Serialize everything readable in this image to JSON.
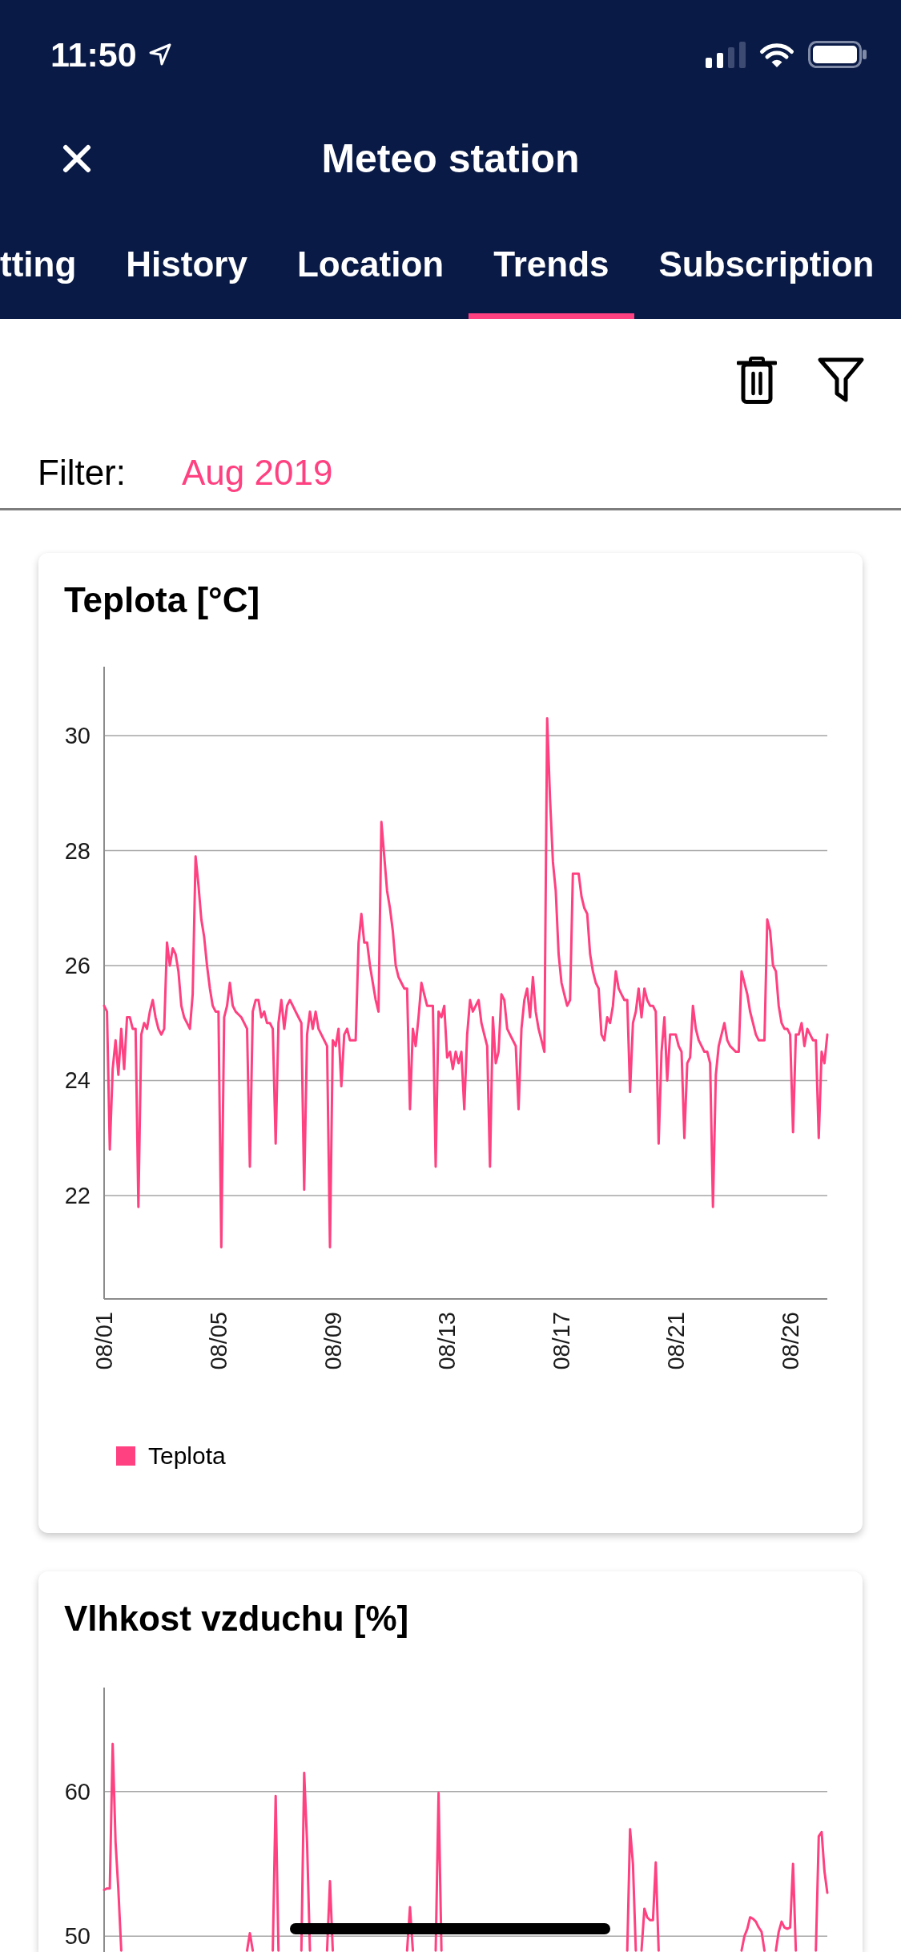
{
  "status_bar": {
    "time": "11:50"
  },
  "header": {
    "title": "Meteo station"
  },
  "tabs": [
    {
      "label": "tting",
      "selected": false
    },
    {
      "label": "History",
      "selected": false
    },
    {
      "label": "Location",
      "selected": false
    },
    {
      "label": "Trends",
      "selected": true
    },
    {
      "label": "Subscription",
      "selected": false
    }
  ],
  "filter": {
    "label": "Filter:",
    "value": "Aug 2019"
  },
  "charts": [
    {
      "title": "Teplota [°C]",
      "chart_data": {
        "type": "line",
        "grid": true,
        "categories": [
          "08/01",
          null,
          null,
          null,
          null,
          null,
          null,
          null,
          null,
          null,
          null,
          null,
          null,
          null,
          null,
          null,
          null,
          null,
          null,
          null,
          null,
          null,
          null,
          null,
          null,
          null,
          null,
          null,
          null,
          null,
          null,
          null,
          null,
          null,
          null,
          null,
          null,
          null,
          null,
          null,
          "08/05",
          null,
          null,
          null,
          null,
          null,
          null,
          null,
          null,
          null,
          null,
          null,
          null,
          null,
          null,
          null,
          null,
          null,
          null,
          null,
          null,
          null,
          null,
          null,
          null,
          null,
          null,
          null,
          null,
          null,
          null,
          null,
          null,
          null,
          null,
          null,
          null,
          null,
          null,
          null,
          "08/09",
          null,
          null,
          null,
          null,
          null,
          null,
          null,
          null,
          null,
          null,
          null,
          null,
          null,
          null,
          null,
          null,
          null,
          null,
          null,
          null,
          null,
          null,
          null,
          null,
          null,
          null,
          null,
          null,
          null,
          null,
          null,
          null,
          null,
          null,
          null,
          null,
          null,
          null,
          null,
          "08/13",
          null,
          null,
          null,
          null,
          null,
          null,
          null,
          null,
          null,
          null,
          null,
          null,
          null,
          null,
          null,
          null,
          null,
          null,
          null,
          null,
          null,
          null,
          null,
          null,
          null,
          null,
          null,
          null,
          null,
          null,
          null,
          null,
          null,
          null,
          null,
          null,
          null,
          null,
          null,
          "08/17",
          null,
          null,
          null,
          null,
          null,
          null,
          null,
          null,
          null,
          null,
          null,
          null,
          null,
          null,
          null,
          null,
          null,
          null,
          null,
          null,
          null,
          null,
          null,
          null,
          null,
          null,
          null,
          null,
          null,
          null,
          null,
          null,
          null,
          null,
          null,
          null,
          null,
          null,
          null,
          "08/21",
          null,
          null,
          null,
          null,
          null,
          null,
          null,
          null,
          null,
          null,
          null,
          null,
          null,
          null,
          null,
          null,
          null,
          null,
          null,
          null,
          null,
          null,
          null,
          null,
          null,
          null,
          null,
          null,
          null,
          null,
          null,
          null,
          null,
          null,
          null,
          null,
          null,
          null,
          null,
          "08/26",
          null,
          null,
          null,
          null,
          null,
          null,
          null,
          null,
          null,
          null,
          null,
          null,
          null
        ],
        "series": [
          {
            "name": "Teplota",
            "color": "#ff4081",
            "values": [
              25.3,
              25.2,
              22.8,
              24.2,
              24.7,
              24.1,
              24.9,
              24.2,
              25.1,
              25.1,
              24.9,
              24.9,
              21.8,
              24.8,
              25.0,
              24.9,
              25.2,
              25.4,
              25.1,
              24.9,
              24.8,
              24.9,
              26.4,
              26.0,
              26.3,
              26.2,
              25.9,
              25.3,
              25.1,
              25.0,
              24.9,
              25.5,
              27.9,
              27.4,
              26.8,
              26.5,
              26.0,
              25.6,
              25.3,
              25.2,
              25.2,
              21.1,
              25.1,
              25.3,
              25.7,
              25.3,
              25.2,
              25.15,
              25.1,
              25.0,
              24.9,
              22.5,
              25.2,
              25.4,
              25.4,
              25.1,
              25.2,
              25.0,
              25.0,
              24.9,
              22.9,
              25.0,
              25.4,
              24.9,
              25.3,
              25.4,
              25.3,
              25.2,
              25.1,
              25.0,
              22.1,
              24.8,
              25.2,
              24.9,
              25.2,
              24.9,
              24.8,
              24.7,
              24.6,
              21.1,
              24.7,
              24.6,
              24.9,
              23.9,
              24.8,
              24.9,
              24.7,
              24.7,
              24.7,
              26.4,
              26.9,
              26.4,
              26.4,
              26.0,
              25.7,
              25.4,
              25.2,
              28.5,
              27.9,
              27.3,
              27.0,
              26.6,
              26.0,
              25.8,
              25.7,
              25.6,
              25.6,
              23.5,
              24.9,
              24.6,
              25.1,
              25.7,
              25.5,
              25.3,
              25.3,
              25.3,
              22.5,
              25.2,
              25.1,
              25.3,
              24.4,
              24.5,
              24.2,
              24.5,
              24.3,
              24.5,
              23.5,
              24.8,
              25.4,
              25.2,
              25.3,
              25.4,
              25.0,
              24.8,
              24.6,
              22.5,
              25.1,
              24.3,
              24.5,
              25.5,
              25.4,
              24.9,
              24.8,
              24.7,
              24.6,
              23.5,
              24.9,
              25.4,
              25.6,
              25.1,
              25.8,
              25.2,
              24.9,
              24.7,
              24.5,
              30.3,
              28.9,
              27.8,
              27.3,
              26.2,
              25.7,
              25.5,
              25.3,
              25.4,
              27.6,
              27.6,
              27.6,
              27.2,
              27.0,
              26.9,
              26.2,
              25.9,
              25.7,
              25.6,
              24.8,
              24.7,
              25.1,
              25.0,
              25.3,
              25.9,
              25.6,
              25.5,
              25.4,
              25.4,
              23.8,
              25.0,
              25.2,
              25.6,
              25.1,
              25.6,
              25.4,
              25.3,
              25.3,
              25.2,
              22.9,
              24.5,
              25.1,
              24.0,
              24.8,
              24.8,
              24.8,
              24.6,
              24.5,
              23.0,
              24.3,
              24.4,
              25.3,
              24.9,
              24.7,
              24.6,
              24.5,
              24.5,
              24.3,
              21.8,
              24.1,
              24.6,
              24.8,
              25.0,
              24.7,
              24.6,
              24.55,
              24.5,
              24.5,
              25.9,
              25.7,
              25.5,
              25.2,
              25.0,
              24.8,
              24.7,
              24.7,
              24.7,
              26.8,
              26.6,
              26.0,
              25.9,
              25.3,
              25.0,
              24.9,
              24.9,
              24.8,
              23.1,
              24.8,
              24.8,
              25.0,
              24.6,
              24.9,
              24.8,
              24.7,
              24.7,
              23.0,
              24.5,
              24.3,
              24.8
            ]
          }
        ],
        "ylim": [
          20.2,
          31.2
        ],
        "yticks": [
          22,
          24,
          26,
          28,
          30
        ]
      }
    },
    {
      "title": "Vlhkost vzduchu [%]",
      "chart_data": {
        "type": "line",
        "grid": true,
        "categories": [
          null,
          null,
          null,
          null,
          null,
          null,
          null,
          null,
          null,
          null,
          null,
          null,
          null,
          null,
          null,
          null,
          null,
          null,
          null,
          null,
          null,
          null,
          null,
          null,
          null,
          null,
          null,
          null,
          null,
          null,
          null,
          null,
          null,
          null,
          null,
          null,
          null,
          null,
          null,
          null,
          null,
          null,
          null,
          null,
          null,
          null,
          null,
          null,
          null,
          null,
          null,
          null,
          null,
          null,
          null,
          null,
          null,
          null,
          null,
          null,
          null,
          null,
          null,
          null,
          null,
          null,
          null,
          null,
          null,
          null,
          null,
          null,
          null,
          null,
          null,
          null,
          null,
          null,
          null,
          null,
          null,
          null,
          null,
          null,
          null,
          null,
          null,
          null,
          null,
          null,
          null,
          null,
          null,
          null,
          null,
          null,
          null,
          null,
          null,
          null,
          null,
          null,
          null,
          null,
          null,
          null,
          null,
          null,
          null,
          null,
          null,
          null,
          null,
          null,
          null,
          null,
          null,
          null,
          null,
          null,
          null,
          null,
          null,
          null,
          null,
          null,
          null,
          null,
          null,
          null,
          null,
          null,
          null,
          null,
          null,
          null,
          null,
          null,
          null,
          null,
          null,
          null,
          null,
          null,
          null,
          null,
          null,
          null,
          null,
          null,
          null,
          null,
          null,
          null,
          null,
          null,
          null,
          null,
          null,
          null,
          null,
          null,
          null,
          null,
          null,
          null,
          null,
          null,
          null,
          null,
          null,
          null,
          null,
          null,
          null,
          null,
          null,
          null,
          null,
          null,
          null,
          null,
          null,
          null,
          null,
          null,
          null,
          null,
          null,
          null,
          null,
          null,
          null,
          null,
          null,
          null,
          null,
          null,
          null,
          null,
          null,
          null,
          null,
          null,
          null,
          null,
          null,
          null,
          null,
          null,
          null,
          null,
          null,
          null,
          null,
          null,
          null,
          null,
          null,
          null,
          null,
          null,
          null,
          null,
          null,
          null,
          null,
          null,
          null,
          null,
          null,
          null,
          null,
          null,
          null,
          null,
          null,
          null,
          null,
          null,
          null,
          null,
          null,
          null,
          null,
          null,
          null,
          null,
          null,
          null,
          null,
          null,
          null,
          null
        ],
        "series": [
          {
            "color": "#ff4081",
            "values": [
              53.2,
              53.3,
              53.3,
              63.3,
              56.5,
              53.2,
              49,
              null,
              null,
              null,
              null,
              null,
              null,
              null,
              null,
              null,
              null,
              null,
              null,
              null,
              null,
              null,
              null,
              null,
              null,
              null,
              null,
              null,
              null,
              null,
              null,
              null,
              null,
              null,
              null,
              null,
              null,
              null,
              null,
              null,
              null,
              null,
              null,
              null,
              null,
              null,
              null,
              null,
              null,
              null,
              49,
              50.2,
              49,
              null,
              null,
              null,
              null,
              null,
              null,
              49,
              59.7,
              49,
              null,
              null,
              null,
              null,
              null,
              null,
              null,
              49,
              61.3,
              56.5,
              49,
              null,
              null,
              null,
              null,
              null,
              49,
              53.8,
              49,
              null,
              null,
              null,
              null,
              null,
              null,
              null,
              null,
              null,
              null,
              null,
              null,
              null,
              null,
              null,
              null,
              null,
              null,
              null,
              null,
              null,
              null,
              null,
              null,
              null,
              49,
              52.0,
              49,
              null,
              null,
              null,
              null,
              null,
              null,
              null,
              49,
              59.9,
              49,
              null,
              null,
              null,
              null,
              null,
              null,
              null,
              null,
              null,
              null,
              null,
              null,
              null,
              null,
              null,
              null,
              null,
              null,
              null,
              null,
              null,
              null,
              null,
              null,
              null,
              null,
              null,
              null,
              null,
              null,
              null,
              null,
              null,
              null,
              null,
              null,
              null,
              null,
              null,
              null,
              null,
              null,
              null,
              null,
              null,
              null,
              null,
              null,
              null,
              null,
              null,
              null,
              null,
              null,
              null,
              null,
              null,
              null,
              null,
              null,
              null,
              null,
              null,
              null,
              49,
              57.4,
              55.0,
              49,
              null,
              49,
              51.9,
              51.3,
              51.1,
              51.1,
              55.1,
              49,
              null,
              null,
              null,
              null,
              null,
              null,
              null,
              null,
              null,
              null,
              null,
              null,
              null,
              null,
              null,
              null,
              null,
              null,
              null,
              null,
              null,
              null,
              null,
              null,
              null,
              null,
              null,
              null,
              49,
              50.0,
              50.5,
              51.3,
              51.2,
              51.0,
              50.6,
              50.3,
              49,
              null,
              null,
              null,
              49,
              50.3,
              51.0,
              50.6,
              50.5,
              50.6,
              55.0,
              49,
              null,
              null,
              null,
              null,
              null,
              null,
              49,
              56.9,
              57.2,
              54.5,
              53.0
            ]
          }
        ],
        "ylim": [
          48.9,
          67.2
        ],
        "yticks": [
          50,
          60
        ]
      }
    }
  ]
}
